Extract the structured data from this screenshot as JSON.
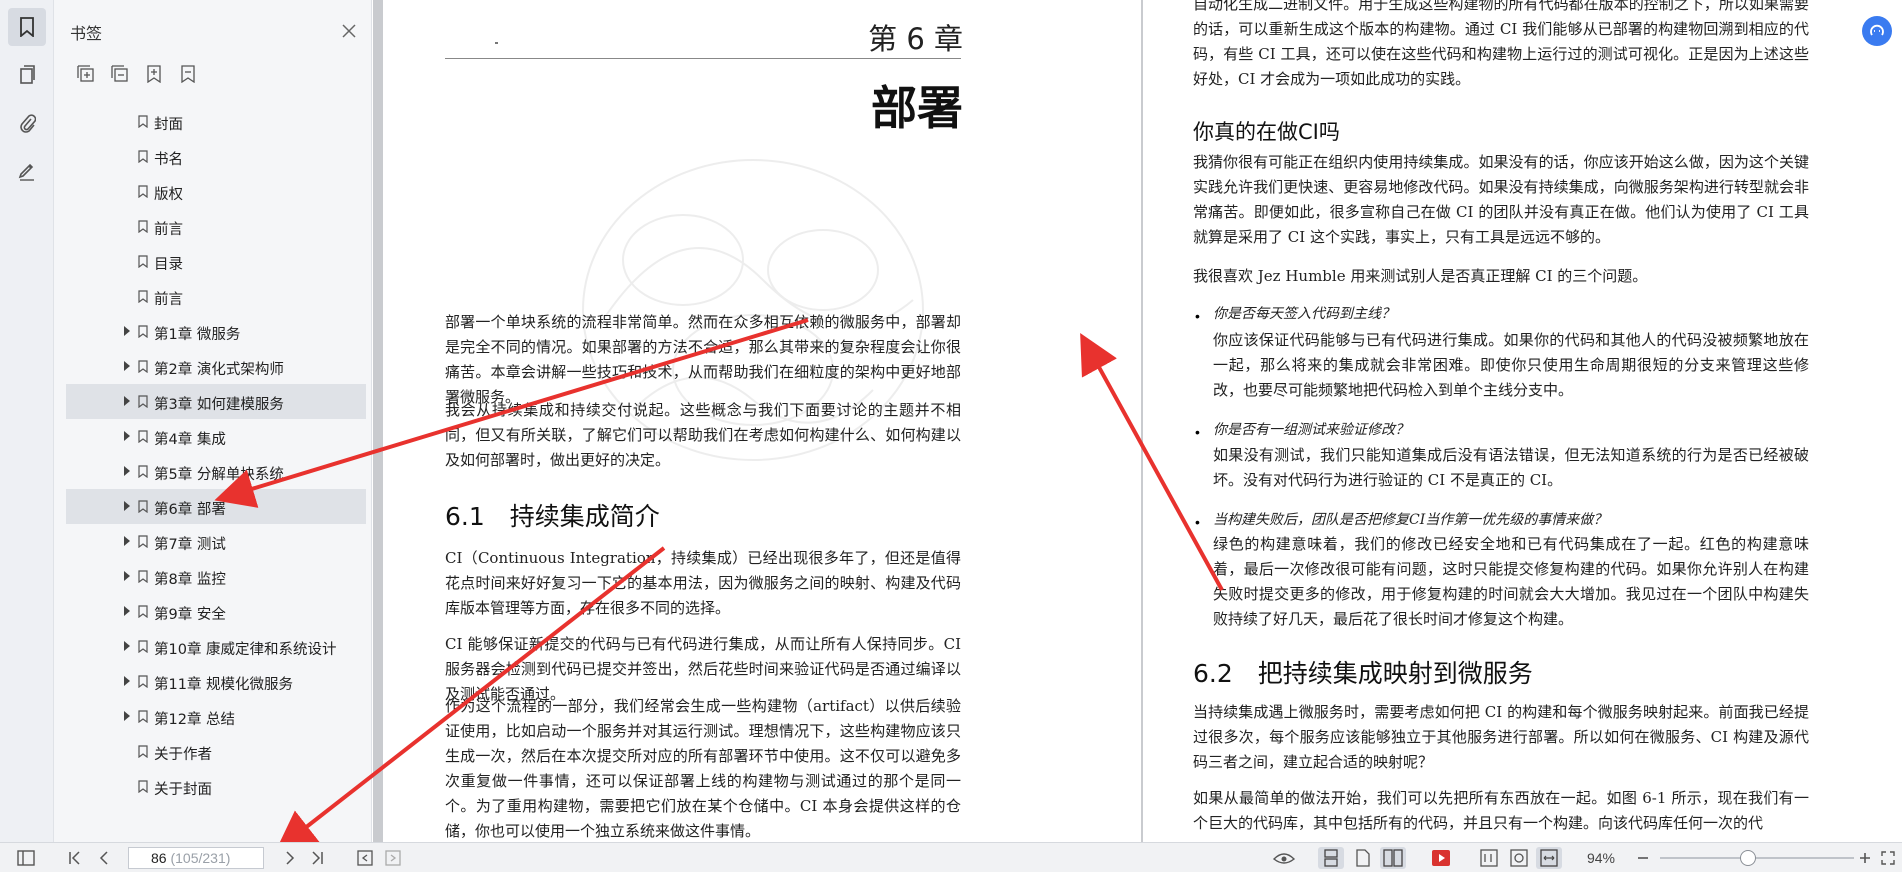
{
  "panel": {
    "title": "书签",
    "bookmarks": [
      {
        "label": "封面",
        "expandable": false,
        "selected": false
      },
      {
        "label": "书名",
        "expandable": false,
        "selected": false
      },
      {
        "label": "版权",
        "expandable": false,
        "selected": false
      },
      {
        "label": "前言",
        "expandable": false,
        "selected": false
      },
      {
        "label": "目录",
        "expandable": false,
        "selected": false
      },
      {
        "label": "前言",
        "expandable": false,
        "selected": false
      },
      {
        "label": "第1章 微服务",
        "expandable": true,
        "selected": false
      },
      {
        "label": "第2章 演化式架构师",
        "expandable": true,
        "selected": false
      },
      {
        "label": "第3章 如何建模服务",
        "expandable": true,
        "selected": true
      },
      {
        "label": "第4章 集成",
        "expandable": true,
        "selected": false
      },
      {
        "label": "第5章 分解单块系统",
        "expandable": true,
        "selected": false
      },
      {
        "label": "第6章 部署",
        "expandable": true,
        "selected": true
      },
      {
        "label": "第7章 测试",
        "expandable": true,
        "selected": false
      },
      {
        "label": "第8章 监控",
        "expandable": true,
        "selected": false
      },
      {
        "label": "第9章 安全",
        "expandable": true,
        "selected": false
      },
      {
        "label": "第10章 康威定律和系统设计",
        "expandable": true,
        "selected": false
      },
      {
        "label": "第11章 规模化微服务",
        "expandable": true,
        "selected": false
      },
      {
        "label": "第12章 总结",
        "expandable": true,
        "selected": false
      },
      {
        "label": "关于作者",
        "expandable": false,
        "selected": false
      },
      {
        "label": "关于封面",
        "expandable": false,
        "selected": false
      }
    ]
  },
  "left_page": {
    "chapter_label": "第 6 章",
    "chapter_title": "部署",
    "intro_p1": "部署一个单块系统的流程非常简单。然而在众多相互依赖的微服务中，部署却是完全不同的情况。如果部署的方法不合适，那么其带来的复杂程度会让你很痛苦。本章会讲解一些技巧和技术，从而帮助我们在细粒度的架构中更好地部署微服务。",
    "intro_p2": "我会从持续集成和持续交付说起。这些概念与我们下面要讨论的主题并不相同，但又有所关联，了解它们可以帮助我们在考虑如何构建什么、如何构建以及如何部署时，做出更好的决定。",
    "section_title": "6.1　持续集成简介",
    "s1_p1": "CI（Continuous Integration，持续集成）已经出现很多年了，但还是值得花点时间来好好复习一下它的基本用法，因为微服务之间的映射、构建及代码库版本管理等方面，存在很多不同的选择。",
    "s1_p2": "CI 能够保证新提交的代码与已有代码进行集成，从而让所有人保持同步。CI 服务器会检测到代码已提交并签出，然后花些时间来验证代码是否通过编译以及测试能否通过。",
    "s1_p3": "作为这个流程的一部分，我们经常会生成一些构建物（artifact）以供后续验证使用，比如启动一个服务并对其运行测试。理想情况下，这些构建物应该只生成一次，然后在本次提交所对应的所有部署环节中使用。这不仅可以避免多次重复做一件事情，还可以保证部署上线的构建物与测试通过的那个是同一个。为了重用构建物，需要把它们放在某个仓储中。CI 本身会提供这样的仓储，你也可以使用一个独立系统来做这件事情。"
  },
  "right_page": {
    "top_p": "自动化生成二进制文件。用于生成这些构建物的所有代码都在版本的控制之下，所以如果需要的话，可以重新生成这个版本的构建物。通过 CI 我们能够从已部署的构建物回溯到相应的代码，有些 CI 工具，还可以使在这些代码和构建物上运行过的测试可视化。正是因为上述这些好处，CI 才会成为一项如此成功的实践。",
    "heading_ci": "你真的在做CI吗",
    "ci_p1": "我猜你很有可能正在组织内使用持续集成。如果没有的话，你应该开始这么做，因为这个关键实践允许我们更快速、更容易地修改代码。如果没有持续集成，向微服务架构进行转型就会非常痛苦。即便如此，很多宣称自己在做 CI 的团队并没有真正在做。他们认为使用了 CI 工具就算是采用了 CI 这个实践，事实上，只有工具是远远不够的。",
    "ci_p2": "我很喜欢 Jez Humble 用来测试别人是否真正理解 CI 的三个问题。",
    "bullets": [
      {
        "q": "你是否每天签入代码到主线？",
        "a": "你应该保证代码能够与已有代码进行集成。如果你的代码和其他人的代码没被频繁地放在一起，那么将来的集成就会非常困难。即使你只使用生命周期很短的分支来管理这些修改，也要尽可能频繁地把代码检入到单个主线分支中。"
      },
      {
        "q": "你是否有一组测试来验证修改？",
        "a": "如果没有测试，我们只能知道集成后没有语法错误，但无法知道系统的行为是否已经被破坏。没有对代码行为进行验证的 CI 不是真正的 CI。"
      },
      {
        "q": "当构建失败后，团队是否把修复CI当作第一优先级的事情来做？",
        "a": "绿色的构建意味着，我们的修改已经安全地和已有代码集成在了一起。红色的构建意味着，最后一次修改很可能有问题，这时只能提交修复构建的代码。如果你允许别人在构建失败时提交更多的修改，用于修复构建的时间就会大大增加。我见过在一个团队中构建失败持续了好几天，最后花了很长时间才修复这个构建。"
      }
    ],
    "section2_title": "6.2　把持续集成映射到微服务",
    "s2_p1": "当持续集成遇上微服务时，需要考虑如何把 CI 的构建和每个微服务映射起来。前面我已经提过很多次，每个服务应该能够独立于其他服务进行部署。所以如何在微服务、CI 构建及源代码三者之间，建立起合适的映射呢？",
    "s2_p2": "如果从最简单的做法开始，我们可以先把所有东西放在一起。如图 6-1 所示，现在我们有一个巨大的代码库，其中包括所有的代码，并且只有一个构建。向该代码库任何一次的代"
  },
  "statusbar": {
    "current_page": "86",
    "page_total": " (105/231)",
    "zoom": "94%"
  },
  "colors": {
    "accent": "#3a7bf0",
    "annotation_red": "#e8322e",
    "play_red": "#d9332f"
  }
}
